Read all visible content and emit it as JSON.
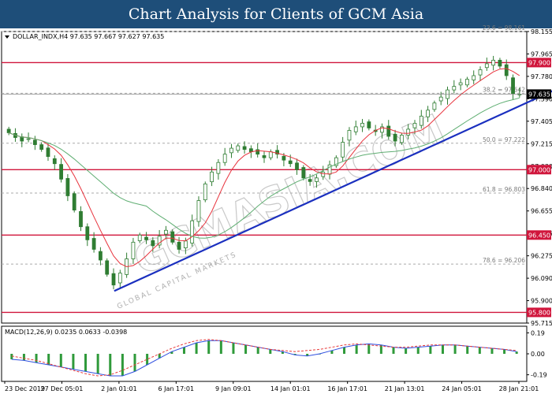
{
  "header": {
    "title": "Chart Analysis for Clients of GCM Asia"
  },
  "symbol_info": "DOLLAR_INDX,H4  97.635 97.667 97.627 97.635",
  "watermark": "GCMASIA.COM",
  "watermark_sub": "GLOBAL CAPITAL MARKETS",
  "colors": {
    "banner": "#1e4e79",
    "candle": "#2f7d32",
    "ma_red": "#e8343e",
    "ma_green": "#5fae72",
    "trendline": "#1a2fbf",
    "hline": "#d0163c",
    "price_tag": "#000000",
    "grid": "#aaaaaa",
    "macd_line": "#3050e0",
    "macd_signal": "#e83a3a",
    "macd_hist": "#2f9a3a"
  },
  "chart_data": {
    "type": "candlestick",
    "y_range": [
      95.71,
      98.161
    ],
    "price_ticks": [
      "98.155",
      "97.965",
      "97.780",
      "97.590",
      "97.405",
      "97.215",
      "97.030",
      "96.840",
      "96.655",
      "96.465",
      "96.275",
      "96.090",
      "95.900",
      "95.715"
    ],
    "x_ticks": [
      "23 Dec 2019",
      "27 Dec 05:01",
      "2 Jan 01:01",
      "6 Jan 17:01",
      "9 Jan 09:01",
      "14 Jan 01:01",
      "16 Jan 17:01",
      "21 Jan 13:01",
      "24 Jan 05:01",
      "28 Jan 21:01"
    ],
    "current_price": 97.635,
    "current_price_label": "97.635",
    "horizontal_levels": [
      {
        "label": "97.900",
        "value": 97.9
      },
      {
        "label": "97.000",
        "value": 97.0
      },
      {
        "label": "96.450",
        "value": 96.45
      },
      {
        "label": "95.800",
        "value": 95.8
      }
    ],
    "fibonacci_levels": [
      {
        "label": "23.6 = 98.161",
        "value": 98.161
      },
      {
        "label": "38.2 = 97.642",
        "value": 97.642
      },
      {
        "label": "50.0 = 97.222",
        "value": 97.222
      },
      {
        "label": "61.8 = 96.803",
        "value": 96.803
      },
      {
        "label": "78.6 = 96.206",
        "value": 96.206
      }
    ],
    "trendline": {
      "x_start": "2 Jan 01:01",
      "y_start": 95.98,
      "x_end": "28 Jan 21:01",
      "y_end": 97.75
    },
    "closes": [
      97.31,
      97.27,
      97.24,
      97.26,
      97.21,
      97.17,
      97.11,
      97.05,
      96.92,
      96.78,
      96.66,
      96.52,
      96.41,
      96.33,
      96.24,
      96.12,
      96.03,
      96.13,
      96.25,
      96.39,
      96.45,
      96.41,
      96.36,
      96.44,
      96.49,
      96.39,
      96.33,
      96.4,
      96.57,
      96.74,
      96.88,
      96.98,
      97.06,
      97.13,
      97.18,
      97.2,
      97.17,
      97.15,
      97.13,
      97.1,
      97.15,
      97.13,
      97.08,
      97.05,
      97.0,
      96.93,
      96.9,
      96.93,
      96.98,
      97.04,
      97.1,
      97.23,
      97.33,
      97.36,
      97.39,
      97.35,
      97.32,
      97.36,
      97.28,
      97.24,
      97.29,
      97.34,
      97.39,
      97.45,
      97.5,
      97.56,
      97.61,
      97.67,
      97.7,
      97.73,
      97.76,
      97.79,
      97.84,
      97.89,
      97.92,
      97.87,
      97.79,
      97.64,
      97.635
    ],
    "macd": {
      "label": "MACD(12,26,9) 0.0235 0.0633 -0.0398",
      "y_ticks": [
        "0.19",
        "0.00",
        "-0.19"
      ],
      "y_range": [
        -0.25,
        0.25
      ],
      "histogram": [
        -0.05,
        -0.06,
        -0.08,
        -0.1,
        -0.12,
        -0.14,
        -0.16,
        -0.18,
        -0.2,
        -0.2,
        -0.16,
        -0.1,
        -0.04,
        0.02,
        0.06,
        0.1,
        0.12,
        0.12,
        0.1,
        0.08,
        0.06,
        0.04,
        0.02,
        -0.01,
        -0.02,
        0.0,
        0.03,
        0.06,
        0.08,
        0.09,
        0.08,
        0.06,
        0.05,
        0.06,
        0.07,
        0.08,
        0.08,
        0.07,
        0.06,
        0.05,
        0.04,
        0.02
      ],
      "signal": [
        -0.02,
        -0.04,
        -0.06,
        -0.09,
        -0.12,
        -0.15,
        -0.18,
        -0.2,
        -0.19,
        -0.15,
        -0.1,
        -0.05,
        0.0,
        0.05,
        0.09,
        0.12,
        0.13,
        0.12,
        0.1,
        0.08,
        0.06,
        0.04,
        0.03,
        0.02,
        0.03,
        0.04,
        0.06,
        0.08,
        0.09,
        0.08,
        0.07,
        0.06,
        0.06,
        0.07,
        0.08,
        0.08,
        0.08,
        0.07,
        0.06,
        0.05,
        0.04,
        0.03
      ]
    }
  }
}
